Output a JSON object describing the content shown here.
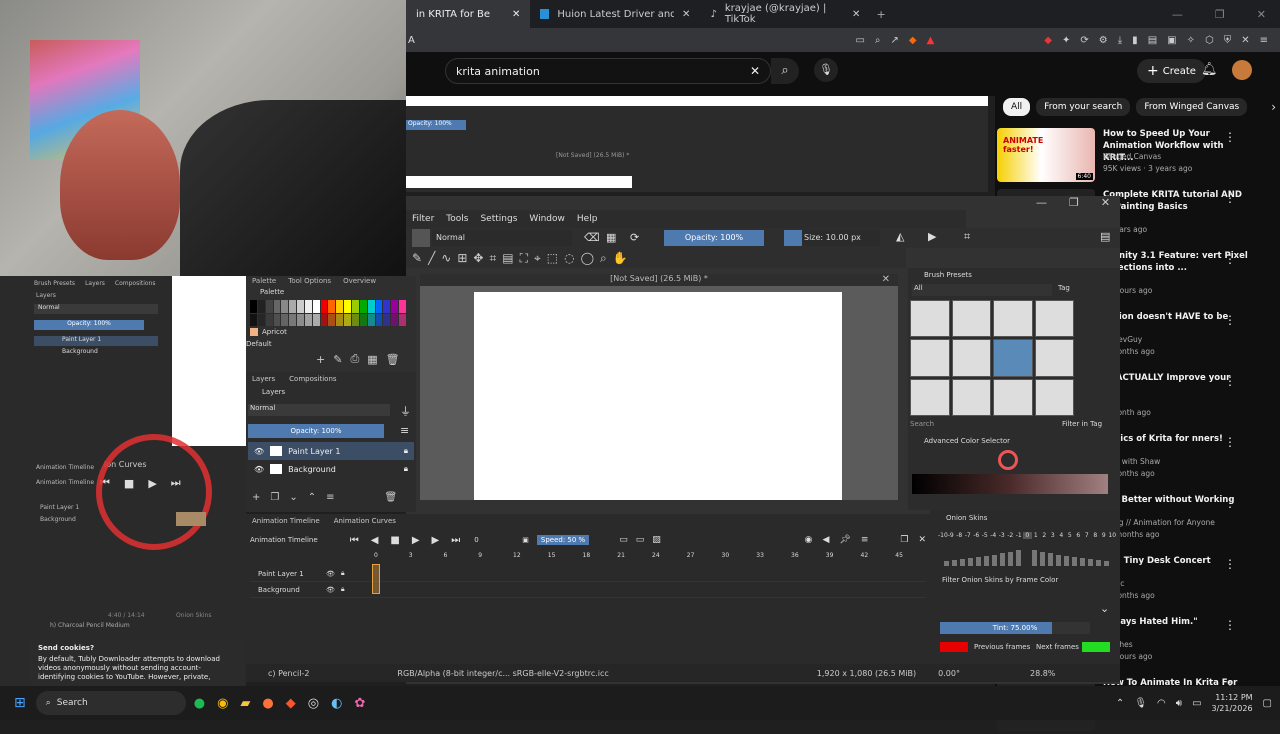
{
  "browser": {
    "tabs": [
      {
        "label": "in KRITA for Be",
        "active": true
      },
      {
        "label": "Huion Latest Driver and Manual Dow",
        "active": false
      },
      {
        "label": "krayjae (@krayjae) | TikTok",
        "active": false
      }
    ],
    "address_fragment": "A"
  },
  "youtube": {
    "search_value": "krita animation",
    "create_label": "Create",
    "filters": [
      "All",
      "From your search",
      "From Winged Canvas"
    ],
    "videos": [
      {
        "title": "How to Speed Up Your Animation Workflow with KRIT...",
        "channel": "Winged Canvas",
        "meta": "95K views · 3 years ago",
        "thumb_text": "ANIMATE faster!",
        "duration": "6:40"
      },
      {
        "title": "Complete KRITA tutorial AND al Painting Basics",
        "channel": "mix",
        "meta": "4 years ago"
      },
      {
        "title": "Affinity 3.1 Feature: vert Pixel Selections into ...",
        "channel": "",
        "meta": "17 hours ago"
      },
      {
        "title": "nation doesn't HAVE to be",
        "channel": "heDevGuy",
        "meta": "9 months ago"
      },
      {
        "title": "to ACTUALLY Improve your",
        "channel": "o",
        "meta": "1 month ago"
      },
      {
        "title": "Basics of Krita for nners!",
        "channel": "hing with Shaw",
        "meta": "5 months ago"
      },
      {
        "title": "ate Better without Working",
        "channel": "Grigg // Animation for Anyone",
        "meta": "10 months ago"
      },
      {
        "title": "ON: Tiny Desk Concert",
        "channel": "Music",
        "meta": "3 months ago"
      },
      {
        "title": "Always Hated Him.\"",
        "channel": "patches",
        "meta": "12 hours ago"
      },
      {
        "title": "How To Animate In Krita For",
        "channel": "",
        "meta": ""
      }
    ]
  },
  "krita": {
    "menu": [
      "Filter",
      "Tools",
      "Settings",
      "Window",
      "Help"
    ],
    "blend_mode": "Normal",
    "opacity": "Opacity: 100%",
    "size": "Size: 10.00 px",
    "doc_title": "[Not Saved]  (26.5 MiB) *",
    "palette_tabs": [
      "Palette",
      "Tool Options",
      "Overview"
    ],
    "palette_section": "Palette",
    "palette_color_name": "Apricot",
    "palette_name": "Default",
    "layers_tabs": [
      "Layers",
      "Compositions"
    ],
    "layers_title": "Layers",
    "layers_blend": "Normal",
    "layers_opacity": "Opacity:  100%",
    "layers": [
      {
        "name": "Paint Layer 1",
        "selected": true
      },
      {
        "name": "Background",
        "selected": false
      }
    ],
    "brush_presets_title": "Brush Presets",
    "brush_filter": "All",
    "brush_tag": "Tag",
    "brush_search_placeholder": "Search",
    "filter_in_tag": "Filter in Tag",
    "color_selector_title": "Advanced Color Selector",
    "anim_tabs": [
      "Animation Timeline",
      "Animation Curves"
    ],
    "anim_title": "Animation Timeline",
    "frame_value": "0",
    "speed": "Speed: 50 %",
    "frame_numbers": [
      "0",
      "3",
      "6",
      "9",
      "12",
      "15",
      "18",
      "21",
      "24",
      "27",
      "30",
      "33",
      "36",
      "39",
      "42",
      "45"
    ],
    "timeline_layers": [
      "Paint Layer 1",
      "Background"
    ],
    "onion_title": "Onion Skins",
    "onion_numbers": [
      "-10",
      "-9",
      "-8",
      "-7",
      "-6",
      "-5",
      "-4",
      "-3",
      "-2",
      "-1",
      "0",
      "1",
      "2",
      "3",
      "4",
      "5",
      "6",
      "7",
      "8",
      "9",
      "10"
    ],
    "onion_filter": "Filter Onion Skins by Frame Color",
    "tint": "Tint: 75.00%",
    "prev_frames": "Previous frames",
    "next_frames": "Next frames",
    "prev_color": "#e60000",
    "next_color": "#22dd22",
    "status_brush": "c) Pencil-2",
    "status_color": "RGB/Alpha (8-bit integer/c... sRGB-elle-V2-srgbtrc.icc",
    "status_dims": "1,920 x 1,080 (26.5 MiB)",
    "status_rotation": "0.00°",
    "status_zoom": "28.8%"
  },
  "left_krita": {
    "tabs": [
      "Brush Presets",
      "Layers",
      "Compositions"
    ],
    "panel_title": "Layers",
    "blend": "Normal",
    "opacity": "Opacity: 100%",
    "layers": [
      "Paint Layer 1",
      "Background"
    ],
    "anim_tab": "Animation Timeline",
    "curves_tab": "ion Curves",
    "anim_title": "Animation Timeline",
    "brush_status": "h) Charcoal Pencil Medium",
    "onion_label": "Onion Skins",
    "frame_counter": "4:40 / 14:14"
  },
  "cookie": {
    "title": "Send cookies?",
    "body": "By default, Tubly Downloader attempts to download videos anonymously without sending account-identifying cookies to YouTube. However, private,"
  },
  "taskbar": {
    "search_label": "Search",
    "time": "11:12 PM",
    "date": "3/21/2026"
  },
  "colors": {
    "accent_blue": "#4e7ab0",
    "recording_circle": "#e03030"
  }
}
